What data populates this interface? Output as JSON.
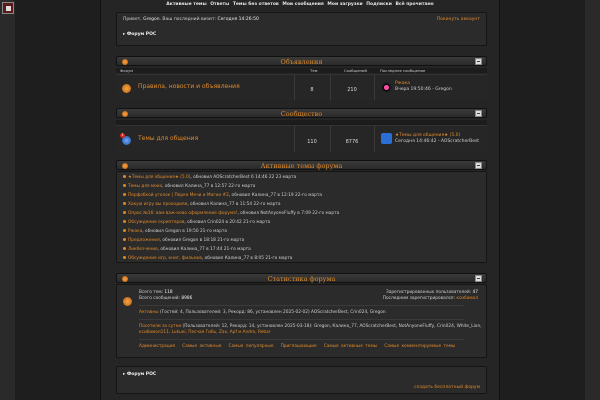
{
  "topnav": [
    "Активные темы",
    "Ответы",
    "Темы без ответов",
    "Мои сообщения",
    "Мои загрузки",
    "Подписки",
    "Всё прочитано"
  ],
  "greeting": {
    "prefix": "Привет,",
    "user": "Gregon",
    "last_visit_label": "Ваш последний визит:",
    "last_visit_value": "Сегодня 14:26:50",
    "logout": "Покинуть аккаунт"
  },
  "breadcrumb": "▸ Форум РОС",
  "categories": [
    {
      "title": "Объявления",
      "headers": {
        "forum": "Форум",
        "topics": "Тем",
        "posts": "Сообщений",
        "last": "Последнее сообщение"
      },
      "forum_name": "Правила, новости и объявления",
      "topics": "8",
      "posts": "210",
      "last_title": "Ржака",
      "last_meta": "Вчера 19:50:46 - Gregon"
    },
    {
      "title": "Сообщество",
      "forum_name": "Темы для общения",
      "topics": "110",
      "posts": "8776",
      "last_title": "★Темы для общения★ (5.0)",
      "last_meta": "Сегодня 14:46:42 - AOScratcherBest",
      "badge": "1"
    }
  ],
  "active_topics": {
    "title": "Активные темы форума",
    "items": [
      {
        "topic": "★Темы для общения★ (5.0)",
        "meta": ", обновил AOScratcherBest 6 14:46 22 23 марта"
      },
      {
        "topic": "Темы для моих",
        "meta": ", обновил Калина_77 в 12:57 22-го марта"
      },
      {
        "topic": "Перфобкой уголок | Перке Мечи и Магии #2",
        "meta": ", обновил Калина_77 в 12:19 22-го марта"
      },
      {
        "topic": "Хакую игру вы проходили",
        "meta": ", обновил Калина_77 в 11:54 22-го марта"
      },
      {
        "topic": "Опрос №16: вам важ-ново оформление форума!",
        "meta": ", обновил NotAnyoneFluffy в 7:09 22-го марта"
      },
      {
        "topic": "Обсуждение скриптеров",
        "meta": ", обновил Crin024 в 20:42 21-го марта"
      },
      {
        "topic": "Ржака",
        "meta": ", обновил Gregon в 19:50 21-го марта"
      },
      {
        "topic": "Предложения",
        "meta": ", обновил Gregon в 18:18 21-го марта"
      },
      {
        "topic": "Ликбезчение",
        "meta": ", обновил Калина_77 в 17:44 21-го марта"
      },
      {
        "topic": "Обсуждение игр, книг, фильмов",
        "meta": ", обновил Калина_77 в 8:05 21-го марта"
      }
    ]
  },
  "statistics": {
    "title": "Статистика форума",
    "total_topics_label": "Всего тем:",
    "total_topics": "118",
    "total_posts_label": "Всего сообщений:",
    "total_posts": "8986",
    "registered_label": "Зарегистрированных пользователей:",
    "registered": "47",
    "last_registered_label": "Последним зарегистрировался:",
    "last_registered": "ксибамол",
    "active_line_label": "Активны",
    "active_line": "(Гостей: 4, Пользователей: 3, Рекорд: 86, установлен 2025-02-02) AOScratcherBest, Crin024, Gregon",
    "visited_label": "Посетили за сутки",
    "visited_line1": "(Пользователей: 12, Рекорд: 14, установлен 2025-03-18): Gregon, Калина_77, AOScratcherBest, NotAnyoneFluffy, Crin024, White_Lion,",
    "visited_line2": "ксибамол111, Lukuei, Песчая Гибь, Zax, Apf и Andre, Rebar",
    "links": [
      "Администрация",
      "Самые активные",
      "Самые популярные",
      "Приглашающие",
      "Самые активные темы",
      "Самые комментируемые темы"
    ]
  },
  "footer": {
    "breadcrumb": "▸ Форум РОС",
    "create_link": "создать бесплатный форум"
  }
}
